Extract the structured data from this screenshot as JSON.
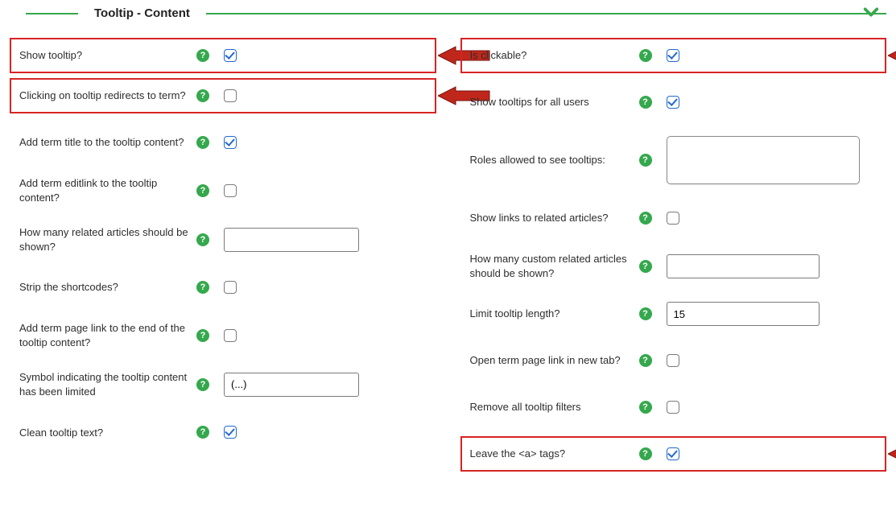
{
  "section_title": "Tooltip - Content",
  "left": {
    "show_tooltip": {
      "label": "Show tooltip?",
      "checked": true,
      "highlight": true,
      "arrow": true
    },
    "click_redirects": {
      "label": "Clicking on tooltip redirects to term?",
      "checked": false,
      "highlight": true,
      "arrow": true
    },
    "add_term_title": {
      "label": "Add term title to the tooltip content?",
      "checked": true
    },
    "add_editlink": {
      "label": "Add term editlink to the tooltip content?",
      "checked": false
    },
    "related_articles_count": {
      "label": "How many related articles should be shown?",
      "value": ""
    },
    "strip_shortcodes": {
      "label": "Strip the shortcodes?",
      "checked": false
    },
    "add_page_link": {
      "label": "Add term page link to the end of the tooltip content?",
      "checked": false
    },
    "limit_symbol": {
      "label": "Symbol indicating the tooltip content has been limited",
      "value": "(...)"
    },
    "clean_text": {
      "label": "Clean tooltip text?",
      "checked": true
    }
  },
  "right": {
    "is_clickable": {
      "label": "Is clickable?",
      "checked": true,
      "highlight": true,
      "arrow": true
    },
    "all_users": {
      "label": "Show tooltips for all users",
      "checked": true
    },
    "roles_allowed": {
      "label": "Roles allowed to see tooltips:",
      "value": ""
    },
    "links_related": {
      "label": "Show links to related articles?",
      "checked": false
    },
    "custom_related_count": {
      "label": "How many custom related articles should be shown?",
      "value": ""
    },
    "limit_length": {
      "label": "Limit tooltip length?",
      "value": "15"
    },
    "open_new_tab": {
      "label": "Open term page link in new tab?",
      "checked": false
    },
    "remove_filters": {
      "label": "Remove all tooltip filters",
      "checked": false
    },
    "leave_a_tags": {
      "label": "Leave the <a> tags?",
      "checked": true,
      "highlight": true,
      "arrow": true
    }
  }
}
